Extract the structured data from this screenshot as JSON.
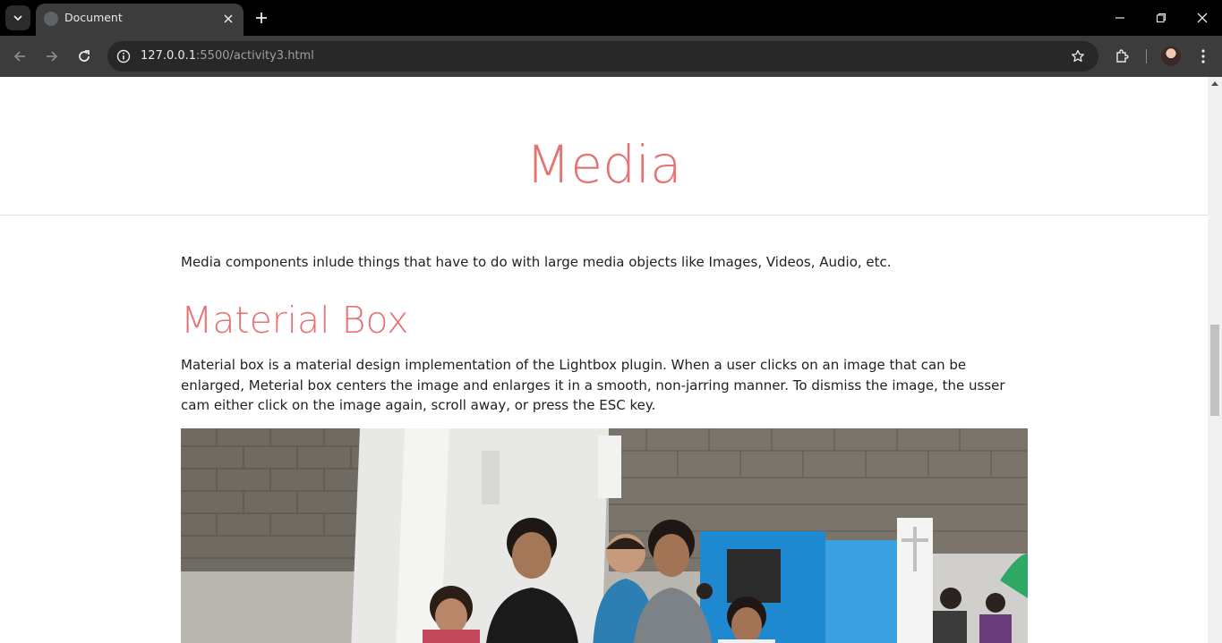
{
  "browser": {
    "tab": {
      "title": "Document"
    },
    "address": {
      "host": "127.0.0.1",
      "rest": ":5500/activity3.html"
    }
  },
  "page": {
    "header": {
      "title": "Media"
    },
    "intro": "Media components inlude things that have to do with large media objects like Images, Videos, Audio, etc.",
    "section": {
      "title": "Material Box",
      "description": "Material box is a material design implementation of the Lightbox plugin. When a user clicks on an image that can be enlarged, Meterial box centers the image and enlarges it in a smooth, non-jarring manner. To dismiss the image, the usser cam either click on the image again, scroll away, or press the ESC key."
    }
  },
  "colors": {
    "accent": "#e57373",
    "chrome_dark": "#3c3c3c",
    "text": "#212121"
  }
}
